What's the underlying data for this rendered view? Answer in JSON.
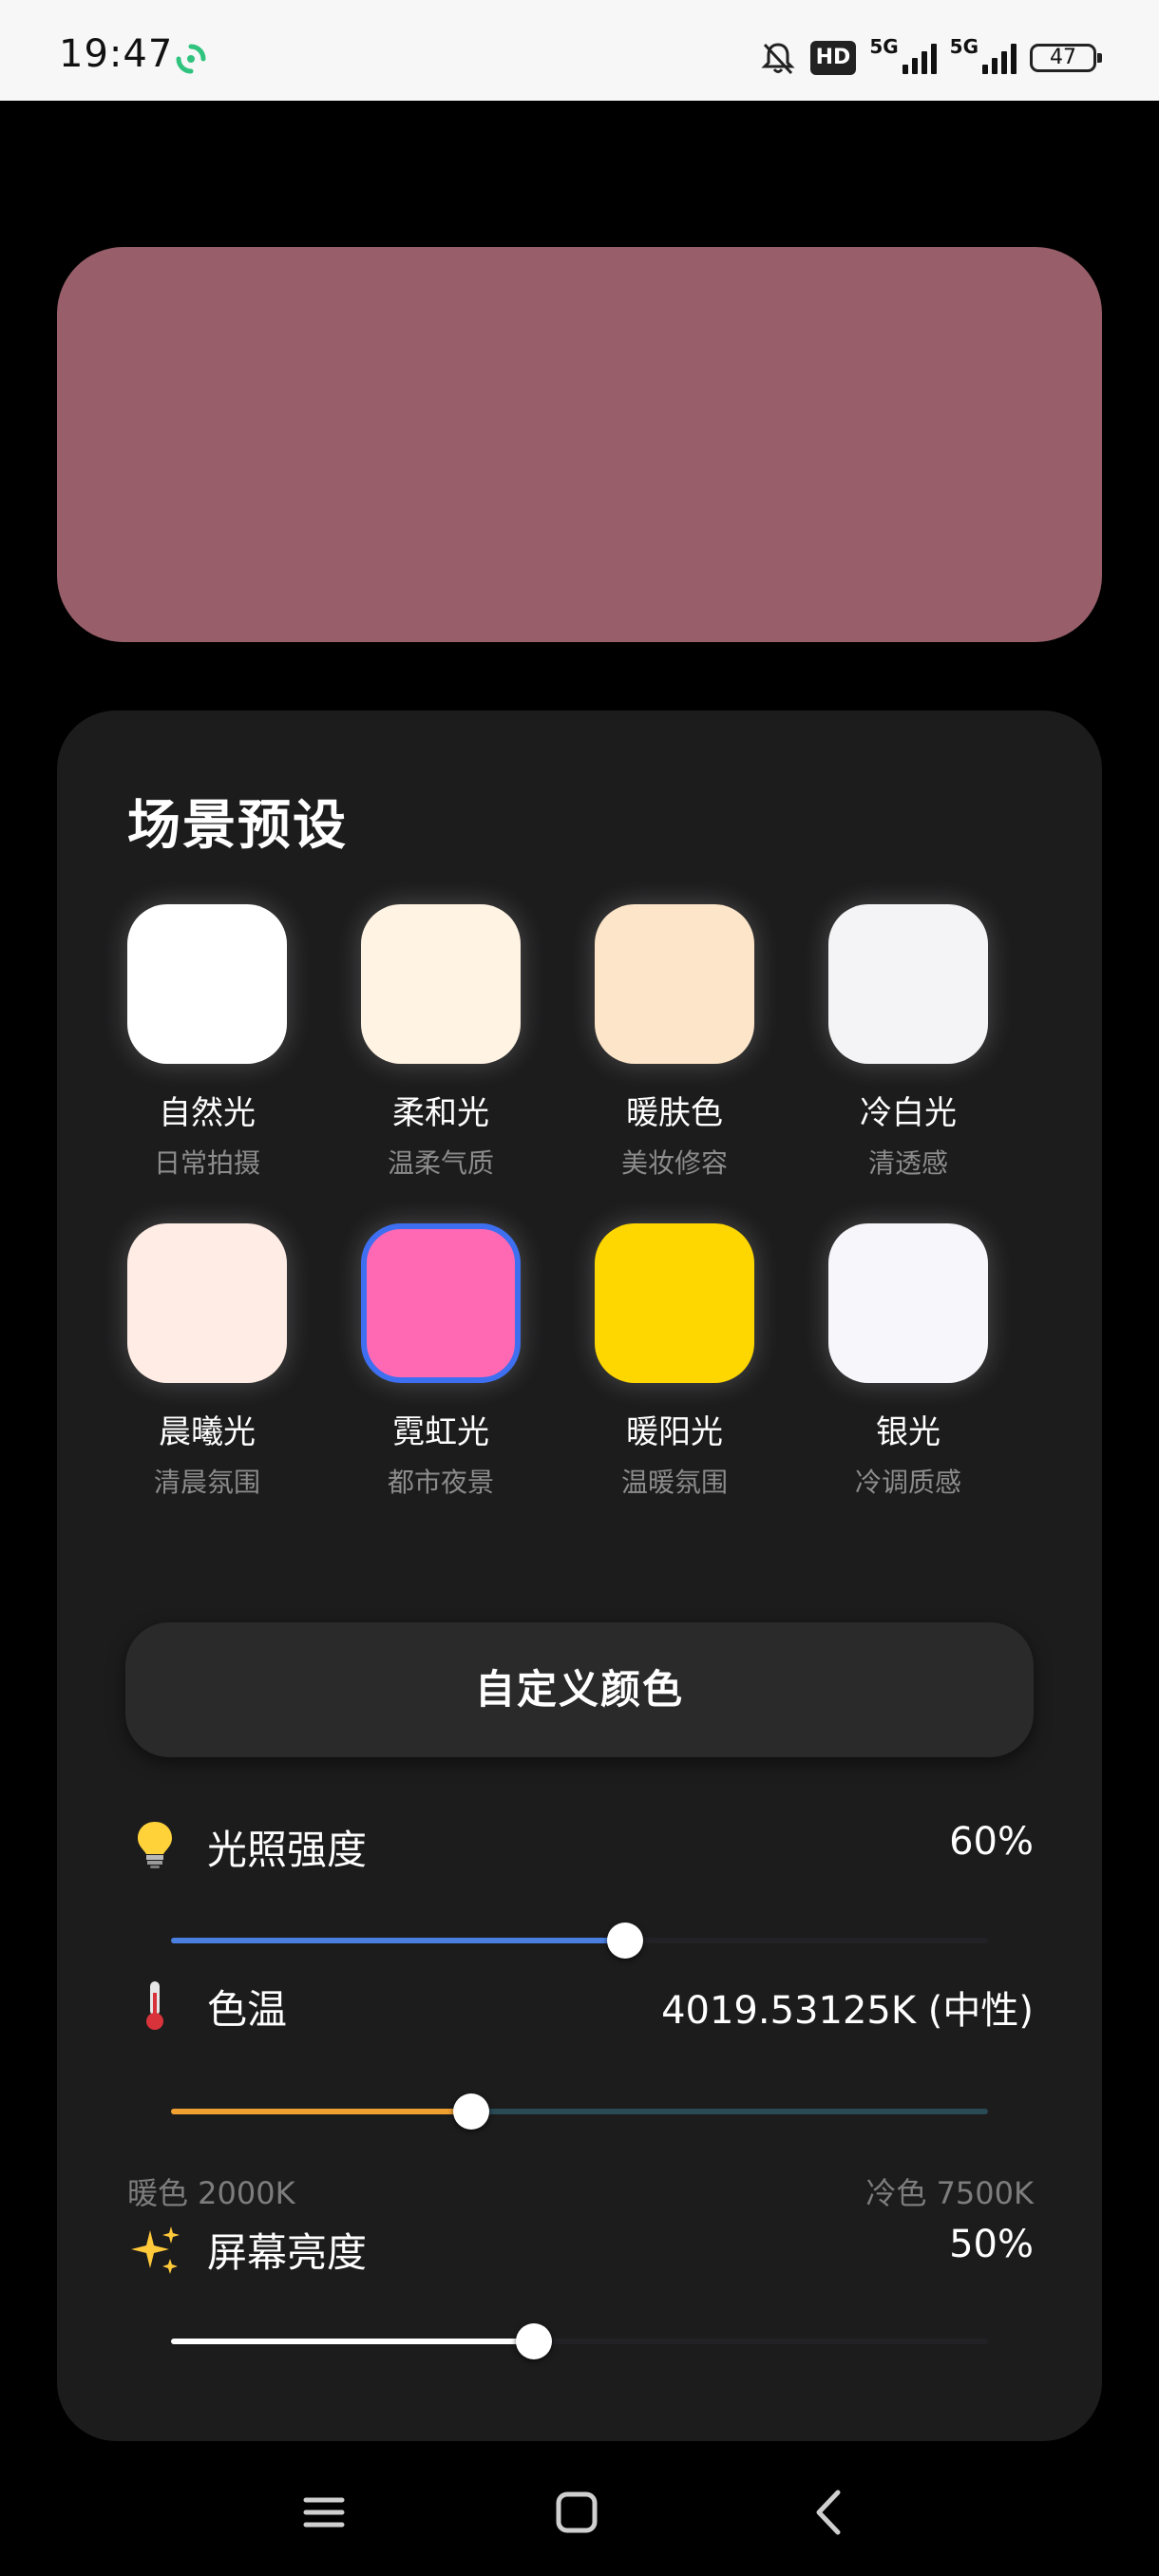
{
  "status_bar": {
    "time": "19:47",
    "hd_label": "HD",
    "network_1": "5G",
    "network_2": "5G",
    "battery": "47",
    "icons": [
      "sync-icon",
      "mute-bell-icon",
      "signal-icon",
      "battery-icon"
    ]
  },
  "preview": {
    "color": "#985f6a"
  },
  "scene": {
    "title": "场景预设",
    "presets": [
      {
        "name": "自然光",
        "desc": "日常拍摄",
        "color": "#ffffff"
      },
      {
        "name": "柔和光",
        "desc": "温柔气质",
        "color": "#fff3e3"
      },
      {
        "name": "暖肤色",
        "desc": "美妆修容",
        "color": "#fce5c8"
      },
      {
        "name": "冷白光",
        "desc": "清透感",
        "color": "#f4f4f6"
      },
      {
        "name": "晨曦光",
        "desc": "清晨氛围",
        "color": "#ffece4"
      },
      {
        "name": "霓虹光",
        "desc": "都市夜景",
        "color": "#ff69b4",
        "selected": true
      },
      {
        "name": "暖阳光",
        "desc": "温暖氛围",
        "color": "#ffd700"
      },
      {
        "name": "银光",
        "desc": "冷调质感",
        "color": "#f6f6fb"
      }
    ]
  },
  "custom_button": {
    "label": "自定义颜色"
  },
  "controls": {
    "light_intensity": {
      "icon": "lightbulb-icon",
      "label": "光照强度",
      "value_text": "60%",
      "level": 0.556,
      "fill_color": "#4a7fe0",
      "track_color": "#222226"
    },
    "color_temperature": {
      "icon": "thermometer-icon",
      "label": "色温",
      "value_text": "4019.53125K (中性)",
      "level": 0.368,
      "fill_color": "#f0a030",
      "track_color": "#2a4a55",
      "warm_label": "暖色 2000K",
      "cool_label": "冷色 7500K"
    },
    "screen_brightness": {
      "icon": "sparkles-icon",
      "label": "屏幕亮度",
      "value_text": "50%",
      "level": 0.444,
      "fill_color": "#ffffff",
      "track_color": "#222226"
    }
  }
}
